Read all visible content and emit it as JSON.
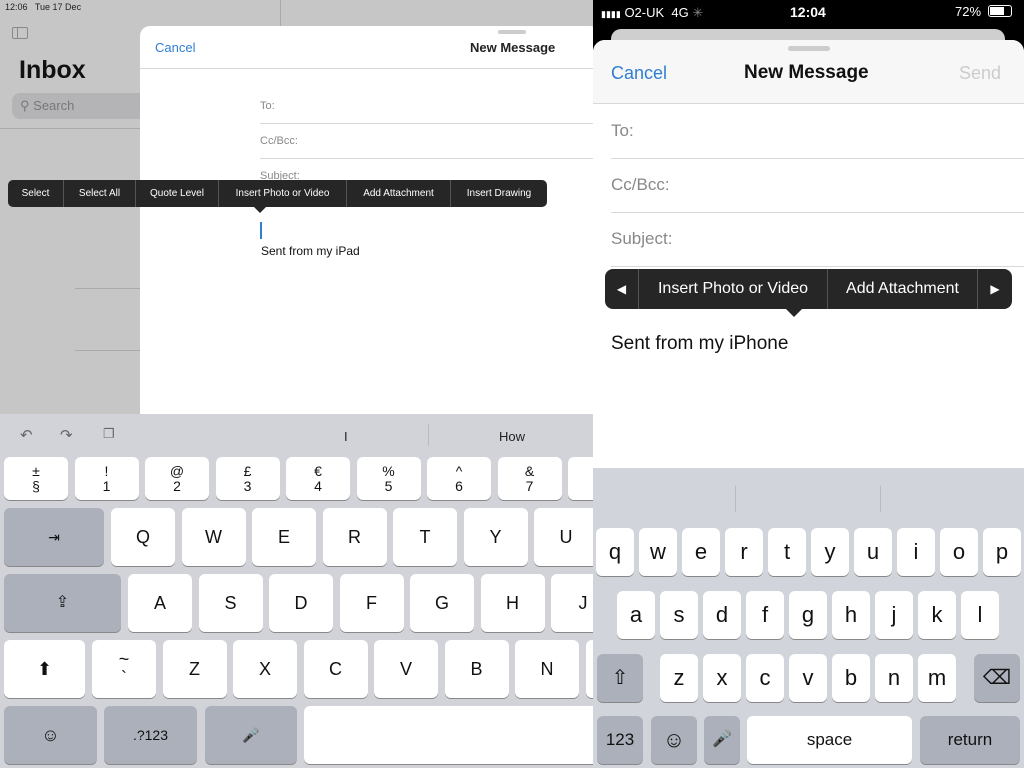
{
  "ipad": {
    "status": {
      "time": "12:06",
      "date": "Tue 17 Dec"
    },
    "sidebar": {
      "title": "Inbox",
      "search_placeholder": "Search",
      "sidebar_icon": "sidebar-toggle-icon"
    },
    "compose": {
      "cancel": "Cancel",
      "title": "New Message",
      "to": "To:",
      "ccbcc": "Cc/Bcc:",
      "subject": "Subject:",
      "body": "Sent from my iPad"
    },
    "edit_menu": [
      "Select",
      "Select All",
      "Quote Level",
      "Insert Photo or Video",
      "Add Attachment",
      "Insert Drawing"
    ],
    "suggestions": [
      "I",
      "How"
    ],
    "toolbar_icons": [
      "undo-icon",
      "redo-icon",
      "paste-icon"
    ],
    "keyboard": {
      "number_row": [
        [
          "±",
          "§"
        ],
        [
          "!",
          "1"
        ],
        [
          "@",
          "2"
        ],
        [
          "£",
          "3"
        ],
        [
          "€",
          "4"
        ],
        [
          "%",
          "5"
        ],
        [
          "^",
          "6"
        ],
        [
          "&",
          "7"
        ],
        [
          "",
          ""
        ]
      ],
      "row1": [
        "Q",
        "W",
        "E",
        "R",
        "T",
        "Y",
        "U"
      ],
      "row2": [
        "A",
        "S",
        "D",
        "F",
        "G",
        "H",
        "J"
      ],
      "row3": [
        [
          "~",
          "`"
        ],
        [
          "Z",
          ""
        ],
        [
          "X",
          ""
        ],
        [
          "C",
          ""
        ],
        [
          "V",
          ""
        ],
        [
          "B",
          ""
        ],
        [
          "N",
          ""
        ],
        [
          "",
          ""
        ]
      ],
      "tab": "⇥",
      "caps": "⇪",
      "shift": "⬆",
      "emoji": "☺",
      "numbers": ".?123",
      "mic": "🎤"
    }
  },
  "iphone": {
    "status": {
      "carrier": "O2-UK",
      "network": "4G",
      "time": "12:04",
      "battery": "72%",
      "battery_level": 0.72
    },
    "compose": {
      "cancel": "Cancel",
      "title": "New Message",
      "send": "Send",
      "to": "To:",
      "ccbcc": "Cc/Bcc:",
      "subject": "Subject:",
      "body": "Sent from my iPhone"
    },
    "edit_menu": {
      "prev": "◀",
      "items": [
        "Insert Photo or Video",
        "Add Attachment"
      ],
      "next": "▶"
    },
    "keyboard": {
      "row1": [
        "q",
        "w",
        "e",
        "r",
        "t",
        "y",
        "u",
        "i",
        "o",
        "p"
      ],
      "row2": [
        "a",
        "s",
        "d",
        "f",
        "g",
        "h",
        "j",
        "k",
        "l"
      ],
      "row3": [
        "z",
        "x",
        "c",
        "v",
        "b",
        "n",
        "m"
      ],
      "shift": "⇧",
      "backspace": "⌫",
      "numbers": "123",
      "emoji": "☺",
      "mic": "🎤",
      "space": "space",
      "return": "return"
    }
  },
  "colors": {
    "accent": "#2f7fd3",
    "menu": "#262626",
    "keyboard": "#d1d3d9"
  }
}
